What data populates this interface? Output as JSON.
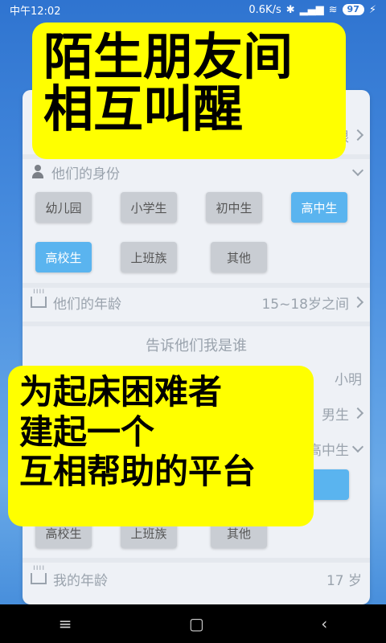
{
  "status_bar": {
    "time": "中午12:02",
    "speed": "0.6K/s",
    "battery": "97"
  },
  "panel": {
    "top_row_value": "不限",
    "their_identity": {
      "label": "他们的身份",
      "chips": [
        {
          "label": "幼儿园",
          "selected": false
        },
        {
          "label": "小学生",
          "selected": false
        },
        {
          "label": "初中生",
          "selected": false
        },
        {
          "label": "高中生",
          "selected": true
        },
        {
          "label": "高校生",
          "selected": true
        },
        {
          "label": "上班族",
          "selected": false
        },
        {
          "label": "其他",
          "selected": false
        }
      ]
    },
    "their_age": {
      "label": "他们的年龄",
      "value": "15~18岁之间"
    },
    "tell_section": {
      "title": "告诉他们我是谁"
    },
    "my_name": {
      "value": "小明"
    },
    "my_gender": {
      "value": "男生"
    },
    "my_identity": {
      "value": "高中生",
      "chips": [
        {
          "label": "高校生",
          "selected": false
        },
        {
          "label": "上班族",
          "selected": false
        },
        {
          "label": "其他",
          "selected": false
        }
      ]
    },
    "my_age": {
      "label": "我的年龄",
      "value": "17 岁"
    }
  },
  "callouts": {
    "top": [
      "陌生朋友间",
      "相互叫醒"
    ],
    "bottom": [
      "为起床困难者",
      "建起一个",
      "互相帮助的平台"
    ]
  },
  "nav": {
    "menu": "≡",
    "home": "▢",
    "back": "‹"
  },
  "colors": {
    "accent": "#5ab4ef",
    "callout": "#ffff00"
  }
}
